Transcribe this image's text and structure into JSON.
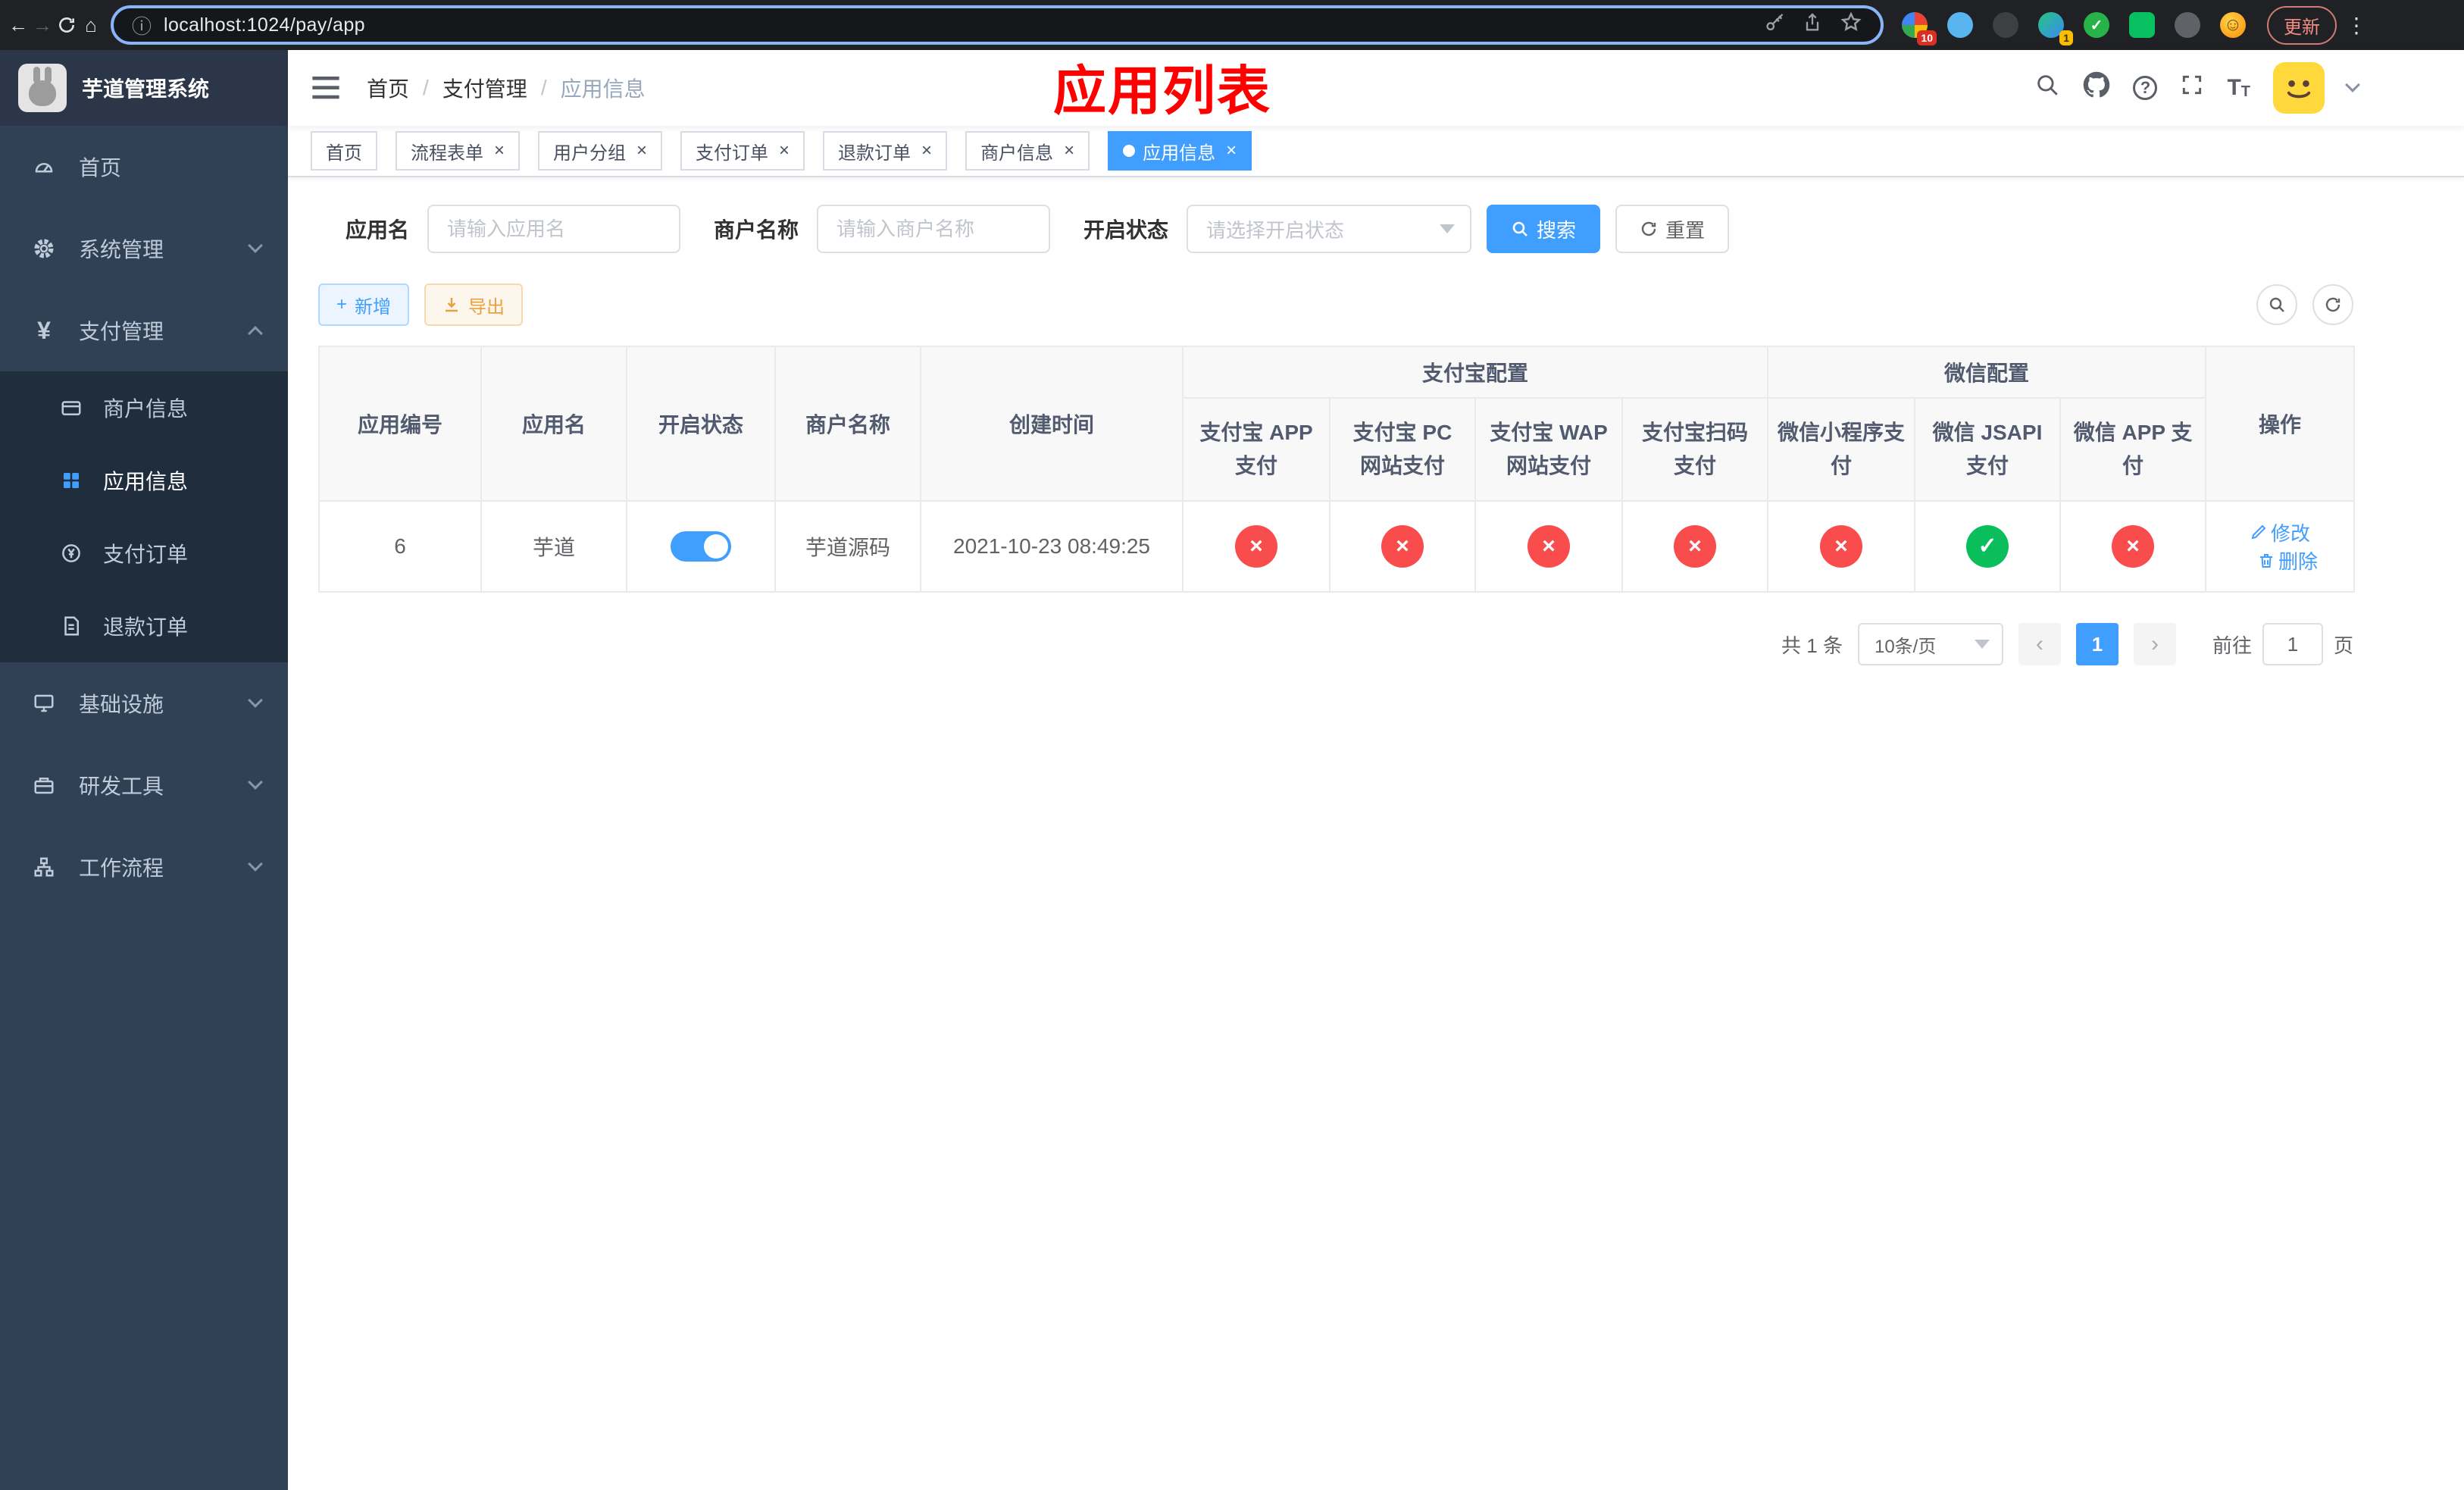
{
  "browser": {
    "url": "localhost:1024/pay/app",
    "update_button": "更新",
    "extension_badges": {
      "first": "10",
      "fourth": "1"
    }
  },
  "sidebar": {
    "logo_title": "芋道管理系统",
    "menu": {
      "home": "首页",
      "system": "系统管理",
      "payment": "支付管理",
      "payment_children": {
        "merchant": "商户信息",
        "app": "应用信息",
        "pay_order": "支付订单",
        "refund_order": "退款订单"
      },
      "infra": "基础设施",
      "devtools": "研发工具",
      "workflow": "工作流程"
    }
  },
  "navbar": {
    "breadcrumb": [
      "首页",
      "支付管理",
      "应用信息"
    ],
    "overlay_title": "应用列表"
  },
  "tabs": [
    {
      "label": "首页"
    },
    {
      "label": "流程表单"
    },
    {
      "label": "用户分组"
    },
    {
      "label": "支付订单"
    },
    {
      "label": "退款订单"
    },
    {
      "label": "商户信息"
    },
    {
      "label": "应用信息"
    }
  ],
  "filters": {
    "app_name": {
      "label": "应用名",
      "placeholder": "请输入应用名"
    },
    "merchant_name": {
      "label": "商户名称",
      "placeholder": "请输入商户名称"
    },
    "status": {
      "label": "开启状态",
      "placeholder": "请选择开启状态"
    },
    "search": "搜索",
    "reset": "重置"
  },
  "toolbar": {
    "add": "新增",
    "export": "导出"
  },
  "table": {
    "headers": {
      "app_id": "应用编号",
      "app_name": "应用名",
      "status": "开启状态",
      "merchant_name": "商户名称",
      "create_time": "创建时间",
      "alipay_group": "支付宝配置",
      "wechat_group": "微信配置",
      "actions": "操作",
      "alipay_app": "支付宝 APP 支付",
      "alipay_pc": "支付宝 PC 网站支付",
      "alipay_wap": "支付宝 WAP 网站支付",
      "alipay_qr": "支付宝扫码支付",
      "wechat_lite": "微信小程序支付",
      "wechat_jsapi": "微信 JSAPI 支付",
      "wechat_app": "微信 APP 支付"
    },
    "row": {
      "app_id": "6",
      "app_name": "芋道",
      "merchant_name": "芋道源码",
      "create_time": "2021-10-23 08:49:25",
      "edit": "修改",
      "delete": "删除"
    }
  },
  "icons": {
    "cross": "×",
    "check": "✓",
    "smile": "☺"
  },
  "pagination": {
    "total": "共 1 条",
    "page_size": "10条/页",
    "page": "1",
    "goto": "前往",
    "goto_value": "1",
    "unit": "页"
  },
  "colors": {
    "accent": "#409eff",
    "success": "#0abf5b",
    "danger": "#f94c4c",
    "warning": "#e6a23c",
    "sidebar_bg": "#304156",
    "overlay_title": "#ff0000"
  }
}
